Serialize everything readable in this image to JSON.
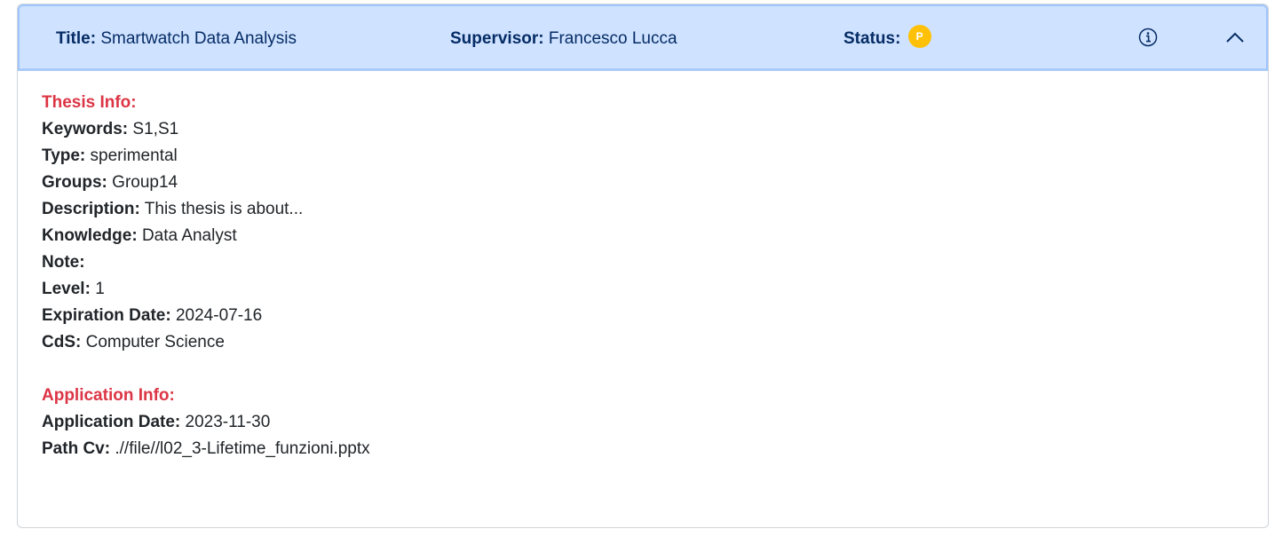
{
  "header": {
    "title_label": "Title:",
    "title_value": "Smartwatch Data Analysis",
    "supervisor_label": "Supervisor:",
    "supervisor_value": "Francesco Lucca",
    "status_label": "Status:",
    "status_badge": "P",
    "status_color": "#ffc107",
    "info_icon": "info-circle-icon",
    "toggle_icon": "chevron-up-icon"
  },
  "thesis_info": {
    "section_title": "Thesis Info:",
    "keywords_label": "Keywords:",
    "keywords_value": "S1,S1",
    "type_label": "Type:",
    "type_value": "sperimental",
    "groups_label": "Groups:",
    "groups_value": "Group14",
    "description_label": "Description:",
    "description_value": "This thesis is about...",
    "knowledge_label": "Knowledge:",
    "knowledge_value": "Data Analyst",
    "note_label": "Note:",
    "note_value": "",
    "level_label": "Level:",
    "level_value": "1",
    "expiration_label": "Expiration Date:",
    "expiration_value": "2024-07-16",
    "cds_label": "CdS:",
    "cds_value": "Computer Science"
  },
  "application_info": {
    "section_title": "Application Info:",
    "date_label": "Application Date:",
    "date_value": "2023-11-30",
    "path_label": "Path Cv:",
    "path_value": ".//file//l02_3-Lifetime_funzioni.pptx"
  },
  "colors": {
    "header_bg": "#cfe2ff",
    "header_text": "#052c65",
    "section_title": "#dc3545",
    "badge": "#ffc107"
  }
}
